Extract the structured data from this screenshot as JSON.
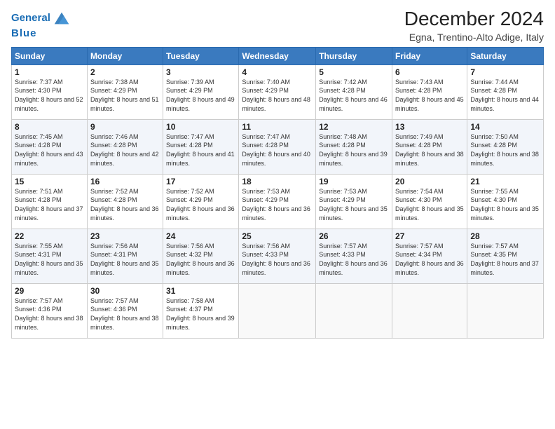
{
  "header": {
    "logo_line1": "General",
    "logo_line2": "Blue",
    "title": "December 2024",
    "subtitle": "Egna, Trentino-Alto Adige, Italy"
  },
  "days_of_week": [
    "Sunday",
    "Monday",
    "Tuesday",
    "Wednesday",
    "Thursday",
    "Friday",
    "Saturday"
  ],
  "weeks": [
    [
      {
        "day": "1",
        "sunrise": "Sunrise: 7:37 AM",
        "sunset": "Sunset: 4:30 PM",
        "daylight": "Daylight: 8 hours and 52 minutes."
      },
      {
        "day": "2",
        "sunrise": "Sunrise: 7:38 AM",
        "sunset": "Sunset: 4:29 PM",
        "daylight": "Daylight: 8 hours and 51 minutes."
      },
      {
        "day": "3",
        "sunrise": "Sunrise: 7:39 AM",
        "sunset": "Sunset: 4:29 PM",
        "daylight": "Daylight: 8 hours and 49 minutes."
      },
      {
        "day": "4",
        "sunrise": "Sunrise: 7:40 AM",
        "sunset": "Sunset: 4:29 PM",
        "daylight": "Daylight: 8 hours and 48 minutes."
      },
      {
        "day": "5",
        "sunrise": "Sunrise: 7:42 AM",
        "sunset": "Sunset: 4:28 PM",
        "daylight": "Daylight: 8 hours and 46 minutes."
      },
      {
        "day": "6",
        "sunrise": "Sunrise: 7:43 AM",
        "sunset": "Sunset: 4:28 PM",
        "daylight": "Daylight: 8 hours and 45 minutes."
      },
      {
        "day": "7",
        "sunrise": "Sunrise: 7:44 AM",
        "sunset": "Sunset: 4:28 PM",
        "daylight": "Daylight: 8 hours and 44 minutes."
      }
    ],
    [
      {
        "day": "8",
        "sunrise": "Sunrise: 7:45 AM",
        "sunset": "Sunset: 4:28 PM",
        "daylight": "Daylight: 8 hours and 43 minutes."
      },
      {
        "day": "9",
        "sunrise": "Sunrise: 7:46 AM",
        "sunset": "Sunset: 4:28 PM",
        "daylight": "Daylight: 8 hours and 42 minutes."
      },
      {
        "day": "10",
        "sunrise": "Sunrise: 7:47 AM",
        "sunset": "Sunset: 4:28 PM",
        "daylight": "Daylight: 8 hours and 41 minutes."
      },
      {
        "day": "11",
        "sunrise": "Sunrise: 7:47 AM",
        "sunset": "Sunset: 4:28 PM",
        "daylight": "Daylight: 8 hours and 40 minutes."
      },
      {
        "day": "12",
        "sunrise": "Sunrise: 7:48 AM",
        "sunset": "Sunset: 4:28 PM",
        "daylight": "Daylight: 8 hours and 39 minutes."
      },
      {
        "day": "13",
        "sunrise": "Sunrise: 7:49 AM",
        "sunset": "Sunset: 4:28 PM",
        "daylight": "Daylight: 8 hours and 38 minutes."
      },
      {
        "day": "14",
        "sunrise": "Sunrise: 7:50 AM",
        "sunset": "Sunset: 4:28 PM",
        "daylight": "Daylight: 8 hours and 38 minutes."
      }
    ],
    [
      {
        "day": "15",
        "sunrise": "Sunrise: 7:51 AM",
        "sunset": "Sunset: 4:28 PM",
        "daylight": "Daylight: 8 hours and 37 minutes."
      },
      {
        "day": "16",
        "sunrise": "Sunrise: 7:52 AM",
        "sunset": "Sunset: 4:28 PM",
        "daylight": "Daylight: 8 hours and 36 minutes."
      },
      {
        "day": "17",
        "sunrise": "Sunrise: 7:52 AM",
        "sunset": "Sunset: 4:29 PM",
        "daylight": "Daylight: 8 hours and 36 minutes."
      },
      {
        "day": "18",
        "sunrise": "Sunrise: 7:53 AM",
        "sunset": "Sunset: 4:29 PM",
        "daylight": "Daylight: 8 hours and 36 minutes."
      },
      {
        "day": "19",
        "sunrise": "Sunrise: 7:53 AM",
        "sunset": "Sunset: 4:29 PM",
        "daylight": "Daylight: 8 hours and 35 minutes."
      },
      {
        "day": "20",
        "sunrise": "Sunrise: 7:54 AM",
        "sunset": "Sunset: 4:30 PM",
        "daylight": "Daylight: 8 hours and 35 minutes."
      },
      {
        "day": "21",
        "sunrise": "Sunrise: 7:55 AM",
        "sunset": "Sunset: 4:30 PM",
        "daylight": "Daylight: 8 hours and 35 minutes."
      }
    ],
    [
      {
        "day": "22",
        "sunrise": "Sunrise: 7:55 AM",
        "sunset": "Sunset: 4:31 PM",
        "daylight": "Daylight: 8 hours and 35 minutes."
      },
      {
        "day": "23",
        "sunrise": "Sunrise: 7:56 AM",
        "sunset": "Sunset: 4:31 PM",
        "daylight": "Daylight: 8 hours and 35 minutes."
      },
      {
        "day": "24",
        "sunrise": "Sunrise: 7:56 AM",
        "sunset": "Sunset: 4:32 PM",
        "daylight": "Daylight: 8 hours and 36 minutes."
      },
      {
        "day": "25",
        "sunrise": "Sunrise: 7:56 AM",
        "sunset": "Sunset: 4:33 PM",
        "daylight": "Daylight: 8 hours and 36 minutes."
      },
      {
        "day": "26",
        "sunrise": "Sunrise: 7:57 AM",
        "sunset": "Sunset: 4:33 PM",
        "daylight": "Daylight: 8 hours and 36 minutes."
      },
      {
        "day": "27",
        "sunrise": "Sunrise: 7:57 AM",
        "sunset": "Sunset: 4:34 PM",
        "daylight": "Daylight: 8 hours and 36 minutes."
      },
      {
        "day": "28",
        "sunrise": "Sunrise: 7:57 AM",
        "sunset": "Sunset: 4:35 PM",
        "daylight": "Daylight: 8 hours and 37 minutes."
      }
    ],
    [
      {
        "day": "29",
        "sunrise": "Sunrise: 7:57 AM",
        "sunset": "Sunset: 4:36 PM",
        "daylight": "Daylight: 8 hours and 38 minutes."
      },
      {
        "day": "30",
        "sunrise": "Sunrise: 7:57 AM",
        "sunset": "Sunset: 4:36 PM",
        "daylight": "Daylight: 8 hours and 38 minutes."
      },
      {
        "day": "31",
        "sunrise": "Sunrise: 7:58 AM",
        "sunset": "Sunset: 4:37 PM",
        "daylight": "Daylight: 8 hours and 39 minutes."
      },
      null,
      null,
      null,
      null
    ]
  ]
}
